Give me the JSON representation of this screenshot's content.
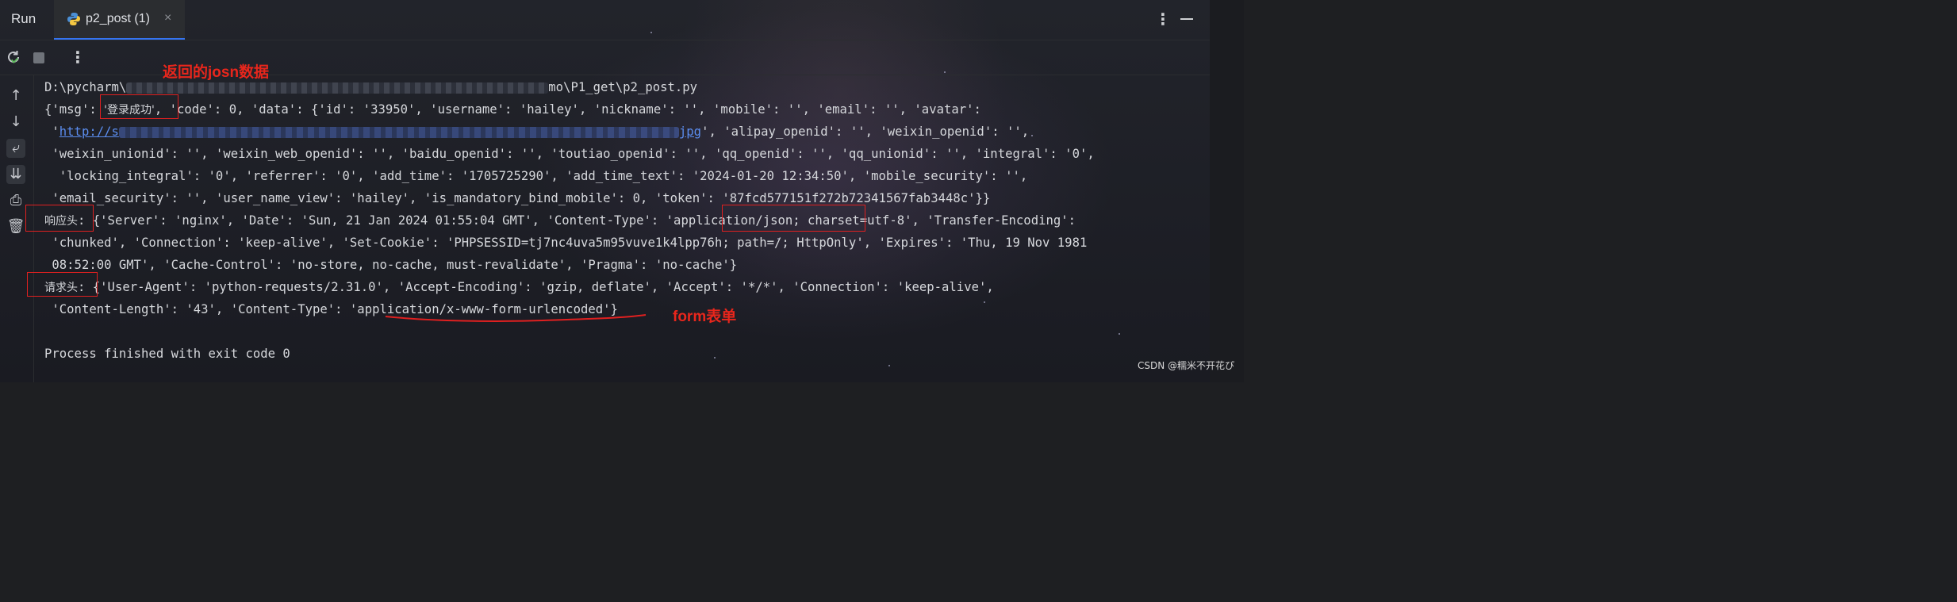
{
  "header": {
    "run_label": "Run",
    "tab_label": "p2_post (1)",
    "tab_close": "×"
  },
  "console": {
    "line1_start": "D:\\pycharm\\",
    "line1_end": "mo\\P1_get\\p2_post.py",
    "line2_a": "{'msg': ",
    "line2_msg": "'登录成功'",
    "line2_b": ", 'code': 0, 'data': {'id': '33950', 'username': 'hailey', 'nickname': '', 'mobile': '', 'email': '', 'avatar':",
    "line3_a": " '",
    "line3_link_a": "http://s",
    "line3_link_b": "jpg",
    "line3_b": "', 'alipay_openid': '', 'weixin_openid': '',",
    "line4": " 'weixin_unionid': '', 'weixin_web_openid': '', 'baidu_openid': '', 'toutiao_openid': '', 'qq_openid': '', 'qq_unionid': '', 'integral': '0',",
    "line5": "  'locking_integral': '0', 'referrer': '0', 'add_time': '1705725290', 'add_time_text': '2024-01-20 12:34:50', 'mobile_security': '',",
    "line6": " 'email_security': '', 'user_name_view': 'hailey', 'is_mandatory_bind_mobile': 0, 'token': '87fcd577151f272b72341567fab3448c'}}",
    "line7_label": "响应头",
    "line7_rest": ": {'Server': 'nginx', 'Date': 'Sun, 21 Jan 2024 01:55:04 GMT', 'Content-Type': 'application/json; charset=utf-8', 'Transfer-Encoding':",
    "line8": " 'chunked', 'Connection': 'keep-alive', 'Set-Cookie': 'PHPSESSID=tj7nc4uva5m95vuve1k4lpp76h; path=/; HttpOnly', 'Expires': 'Thu, 19 Nov 1981",
    "line9": " 08:52:00 GMT', 'Cache-Control': 'no-store, no-cache, must-revalidate', 'Pragma': 'no-cache'}",
    "line10_label": "请求头",
    "line10_rest": ": {'User-Agent': 'python-requests/2.31.0', 'Accept-Encoding': 'gzip, deflate', 'Accept': '*/*', 'Connection': 'keep-alive',",
    "line11": " 'Content-Length': '43', 'Content-Type': 'application/x-www-form-urlencoded'}",
    "line13": "Process finished with exit code 0"
  },
  "annotations": {
    "json_note": "返回的josn数据",
    "form_note": "form表单"
  },
  "watermark": "CSDN @糯米不开花ぴ",
  "colors": {
    "annotation_red": "#e02020",
    "link_blue": "#5b8def",
    "tab_accent": "#3574f0"
  },
  "icons": {
    "tab": "python-file-icon",
    "toolbar": [
      "rerun-icon",
      "stop-icon",
      "more-vertical-icon"
    ],
    "gutter": [
      "arrow-up-icon",
      "arrow-down-icon",
      "soft-wrap-icon",
      "scroll-to-end-icon",
      "print-icon",
      "trash-icon"
    ]
  }
}
